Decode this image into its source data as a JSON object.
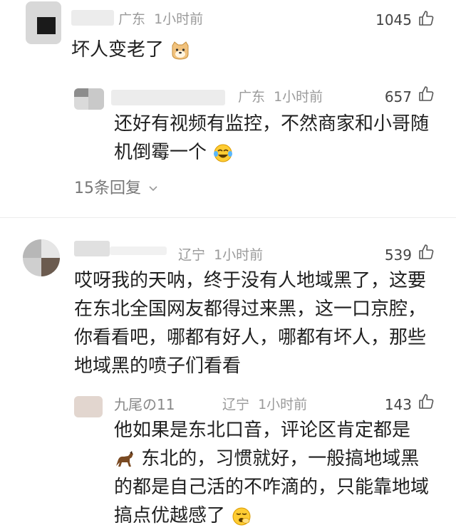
{
  "comments": [
    {
      "location": "广东",
      "time": "1小时前",
      "likes": "1045",
      "text": "坏人变老了",
      "emoji": "dog-face",
      "replies": [
        {
          "location": "广东",
          "time": "1小时前",
          "likes": "657",
          "lines": [
            "还好有视频有监控，不然商家和小哥随",
            "机倒霉一个"
          ],
          "emoji": "laughing-tears-face"
        }
      ],
      "reply_count": "15条回复"
    },
    {
      "location": "辽宁",
      "time": "1小时前",
      "likes": "539",
      "lines": [
        "哎呀我的天呐，终于没有人地域黑了，这要",
        "在东北全国网友都得过来黑，这一口京腔，",
        "你看看吧，哪都有好人，哪都有坏人，那些",
        "地域黑的喷子们看看"
      ],
      "replies": [
        {
          "name": "九尾の11",
          "location": "辽宁",
          "time": "1小时前",
          "likes": "143",
          "lines": [
            "他如果是东北口音，评论区肯定都是",
            "东北的，习惯就好，一般搞地域黑",
            "的都是自己活的不咋滴的，只能靠地域",
            "搞点优越感了"
          ],
          "emoji": "yawn-face",
          "inline_icon": "horse-icon"
        }
      ]
    }
  ],
  "colors": {
    "text": "#1f1f1f",
    "meta": "#9a9a9a",
    "divider": "#ececec"
  }
}
